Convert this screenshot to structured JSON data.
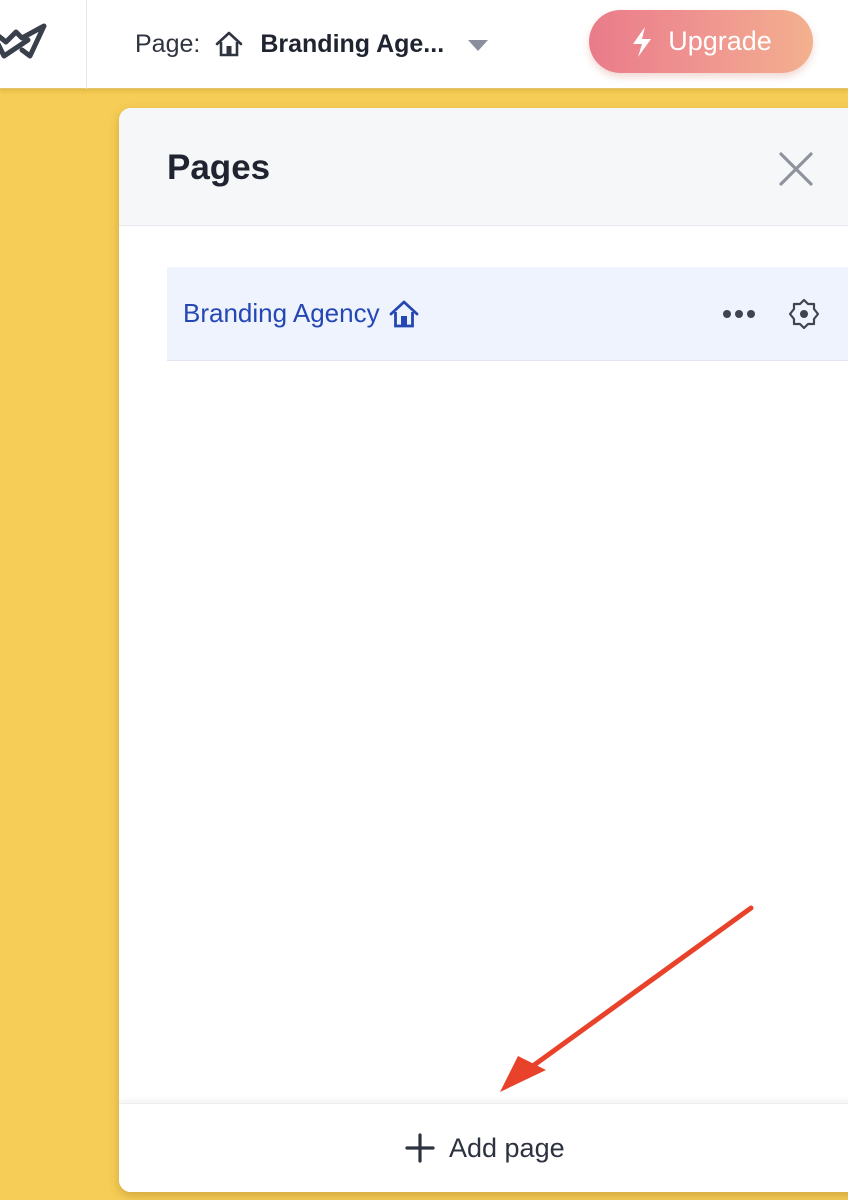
{
  "topbar": {
    "logo_icon": "crown-logo-icon",
    "page_prefix": "Page:",
    "current_page": "Branding Age...",
    "home_icon": "home-icon",
    "dropdown_icon": "caret-down-icon",
    "upgrade_label": "Upgrade",
    "upgrade_icon": "lightning-icon"
  },
  "panel": {
    "title": "Pages",
    "close_icon": "close-icon",
    "pages": [
      {
        "name": "Branding Agency",
        "is_home": true,
        "selected": true,
        "more_icon": "more-horizontal-icon",
        "settings_icon": "gear-icon"
      }
    ],
    "add_page_label": "Add page",
    "add_icon": "plus-icon"
  },
  "annotation": {
    "type": "arrow",
    "color": "#e8432a",
    "points_to": "add-page-button"
  },
  "colors": {
    "background": "#f6cd56",
    "accent_blue": "#2447b3",
    "selected_row": "#eef3fd",
    "upgrade_gradient_start": "#ea7b8a",
    "upgrade_gradient_end": "#f3b08e"
  }
}
